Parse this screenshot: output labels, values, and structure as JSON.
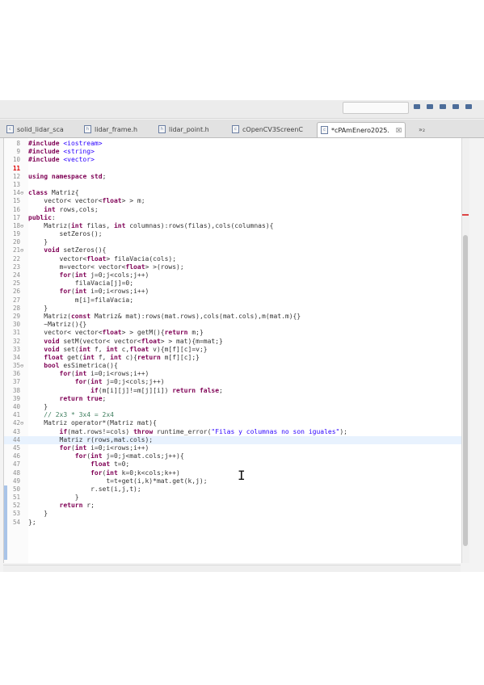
{
  "toolbar": {
    "search_placeholder": ""
  },
  "tabs": [
    {
      "label": "solid_lidar_sca",
      "active": false
    },
    {
      "label": "lidar_frame.h",
      "active": false
    },
    {
      "label": "lidar_point.h",
      "active": false
    },
    {
      "label": "cOpenCV3ScreenC",
      "active": false
    },
    {
      "label": "*cPAmEnero2025.",
      "active": true,
      "close": "☒"
    }
  ],
  "tab_overflow": "»₂",
  "colors": {
    "keyword": "#7f0055",
    "string": "#2a00ff",
    "comment": "#3f7f5f",
    "current_line": "#e8f2fe"
  },
  "editor": {
    "current_line_index": 36,
    "lines": [
      {
        "n": "8",
        "fold": "",
        "code": "#include <iostream>"
      },
      {
        "n": "9",
        "fold": "",
        "code": "#include <string>"
      },
      {
        "n": "10",
        "fold": "",
        "code": "#include <vector>"
      },
      {
        "n": "11",
        "fold": "",
        "code": "",
        "error": true
      },
      {
        "n": "12",
        "fold": "",
        "code": "using namespace std;"
      },
      {
        "n": "13",
        "fold": "",
        "code": ""
      },
      {
        "n": "14",
        "fold": "⊖",
        "code": "class Matriz{"
      },
      {
        "n": "15",
        "fold": "",
        "code": "    vector< vector<float> > m;"
      },
      {
        "n": "16",
        "fold": "",
        "code": "    int rows,cols;"
      },
      {
        "n": "17",
        "fold": "",
        "code": "public:"
      },
      {
        "n": "18",
        "fold": "⊖",
        "code": "    Matriz(int filas, int columnas):rows(filas),cols(columnas){"
      },
      {
        "n": "19",
        "fold": "",
        "code": "        setZeros();"
      },
      {
        "n": "20",
        "fold": "",
        "code": "    }"
      },
      {
        "n": "21",
        "fold": "⊖",
        "code": "    void setZeros(){"
      },
      {
        "n": "22",
        "fold": "",
        "code": "        vector<float> filaVacia(cols);"
      },
      {
        "n": "23",
        "fold": "",
        "code": "        m=vector< vector<float> >(rows);"
      },
      {
        "n": "24",
        "fold": "",
        "code": "        for(int j=0;j<cols;j++)"
      },
      {
        "n": "25",
        "fold": "",
        "code": "            filaVacia[j]=0;"
      },
      {
        "n": "26",
        "fold": "",
        "code": "        for(int i=0;i<rows;i++)"
      },
      {
        "n": "27",
        "fold": "",
        "code": "            m[i]=filaVacia;"
      },
      {
        "n": "28",
        "fold": "",
        "code": "    }"
      },
      {
        "n": "29",
        "fold": "",
        "code": "    Matriz(const Matriz& mat):rows(mat.rows),cols(mat.cols),m(mat.m){}"
      },
      {
        "n": "30",
        "fold": "",
        "code": "    ~Matriz(){}"
      },
      {
        "n": "31",
        "fold": "",
        "code": "    vector< vector<float> > getM(){return m;}"
      },
      {
        "n": "32",
        "fold": "",
        "code": "    void setM(vector< vector<float> > mat){m=mat;}"
      },
      {
        "n": "33",
        "fold": "",
        "code": "    void set(int f, int c,float v){m[f][c]=v;}"
      },
      {
        "n": "34",
        "fold": "",
        "code": "    float get(int f, int c){return m[f][c];}"
      },
      {
        "n": "35",
        "fold": "⊖",
        "code": "    bool esSimetrica(){"
      },
      {
        "n": "36",
        "fold": "",
        "code": "        for(int i=0;i<rows;i++)"
      },
      {
        "n": "37",
        "fold": "",
        "code": "            for(int j=0;j<cols;j++)"
      },
      {
        "n": "38",
        "fold": "",
        "code": "                if(m[i][j]!=m[j][i]) return false;"
      },
      {
        "n": "39",
        "fold": "",
        "code": "        return true;"
      },
      {
        "n": "40",
        "fold": "",
        "code": "    }"
      },
      {
        "n": "41",
        "fold": "",
        "code": "    // 2x3 * 3x4 = 2x4"
      },
      {
        "n": "42",
        "fold": "⊖",
        "code": "    Matriz operator*(Matriz mat){"
      },
      {
        "n": "43",
        "fold": "",
        "code": "        if(mat.rows!=cols) throw runtime_error(\"Filas y columnas no son iguales\");"
      },
      {
        "n": "44",
        "fold": "",
        "code": "        Matriz r(rows,mat.cols);"
      },
      {
        "n": "45",
        "fold": "",
        "code": "        for(int i=0;i<rows;i++)"
      },
      {
        "n": "46",
        "fold": "",
        "code": "            for(int j=0;j<mat.cols;j++){"
      },
      {
        "n": "47",
        "fold": "",
        "code": "                float t=0;"
      },
      {
        "n": "48",
        "fold": "",
        "code": "                for(int k=0;k<cols;k++)"
      },
      {
        "n": "49",
        "fold": "",
        "code": "                    t=t+get(i,k)*mat.get(k,j);"
      },
      {
        "n": "50",
        "fold": "",
        "code": "                r.set(i,j,t);"
      },
      {
        "n": "51",
        "fold": "",
        "code": "            }"
      },
      {
        "n": "52",
        "fold": "",
        "code": "        return r;"
      },
      {
        "n": "53",
        "fold": "",
        "code": "    }"
      },
      {
        "n": "54",
        "fold": "",
        "code": "};"
      }
    ]
  }
}
